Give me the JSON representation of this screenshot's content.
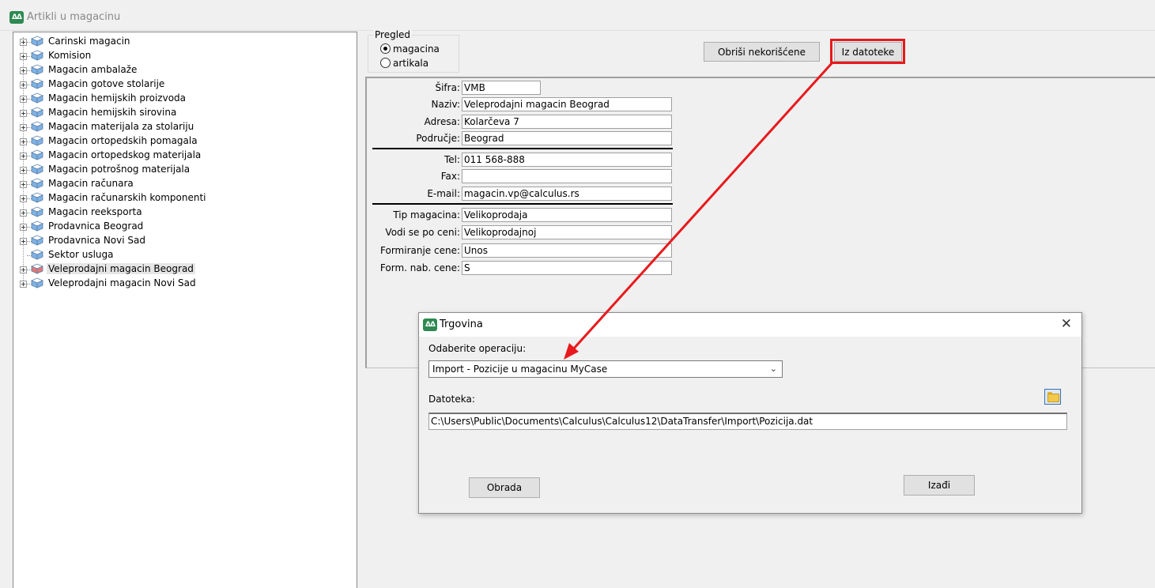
{
  "window": {
    "title": "Artikli u magacinu",
    "icon": "app-logo-icon"
  },
  "tree": {
    "items": [
      {
        "label": "Carinski magacin",
        "expandable": true
      },
      {
        "label": "Komision",
        "expandable": true
      },
      {
        "label": "Magacin ambalaže",
        "expandable": true
      },
      {
        "label": "Magacin gotove stolarije",
        "expandable": true
      },
      {
        "label": "Magacin hemijskih proizvoda",
        "expandable": true
      },
      {
        "label": "Magacin hemijskih sirovina",
        "expandable": true
      },
      {
        "label": "Magacin materijala za stolariju",
        "expandable": true
      },
      {
        "label": "Magacin ortopedskih pomagala",
        "expandable": true
      },
      {
        "label": "Magacin ortopedskog materijala",
        "expandable": true
      },
      {
        "label": "Magacin potrošnog materijala",
        "expandable": true
      },
      {
        "label": "Magacin računara",
        "expandable": true
      },
      {
        "label": "Magacin računarskih komponenti",
        "expandable": true
      },
      {
        "label": "Magacin reeksporta",
        "expandable": true
      },
      {
        "label": "Prodavnica Beograd",
        "expandable": true
      },
      {
        "label": "Prodavnica Novi Sad",
        "expandable": true
      },
      {
        "label": "Sektor usluga",
        "expandable": false
      },
      {
        "label": "Veleprodajni magacin Beograd",
        "expandable": true,
        "selected": true
      },
      {
        "label": "Veleprodajni magacin Novi Sad",
        "expandable": true
      }
    ],
    "icon_color": "#7fb2e5",
    "selected_icon_color": "#e57878"
  },
  "pregled": {
    "title": "Pregled",
    "options": [
      {
        "label": "magacina",
        "checked": true
      },
      {
        "label": "artikala",
        "checked": false
      }
    ]
  },
  "toolbar": {
    "obrisi_label": "Obriši nekorišćene",
    "iz_datoteke_label": "Iz datoteke",
    "highlight_color": "#e8191c"
  },
  "fields": {
    "sifra": {
      "label": "Šifra:",
      "value": "VMB"
    },
    "naziv": {
      "label": "Naziv:",
      "value": "Veleprodajni magacin Beograd"
    },
    "adresa": {
      "label": "Adresa:",
      "value": "Kolarčeva 7"
    },
    "podrucje": {
      "label": "Područje:",
      "value": "Beograd"
    },
    "tel": {
      "label": "Tel:",
      "value": "011 568-888"
    },
    "fax": {
      "label": "Fax:",
      "value": ""
    },
    "email": {
      "label": "E-mail:",
      "value": "magacin.vp@calculus.rs"
    },
    "tip": {
      "label": "Tip magacina:",
      "value": "Velikoprodaja"
    },
    "vodi": {
      "label": "Vodi se po ceni:",
      "value": "Velikoprodajnoj"
    },
    "formiranje": {
      "label": "Formiranje cene:",
      "value": "Unos"
    },
    "formnab": {
      "label": "Form. nab. cene:",
      "value": "S"
    }
  },
  "dialog": {
    "title": "Trgovina",
    "operation_label": "Odaberite operaciju:",
    "operation_value": "Import - Pozicije u magacinu MyCase",
    "file_label": "Datoteka:",
    "file_path": "C:\\Users\\Public\\Documents\\Calculus\\Calculus12\\DataTransfer\\Import\\Pozicija.dat",
    "obrada_label": "Obrada",
    "izadji_label": "Izađi",
    "close_glyph": "✕"
  }
}
